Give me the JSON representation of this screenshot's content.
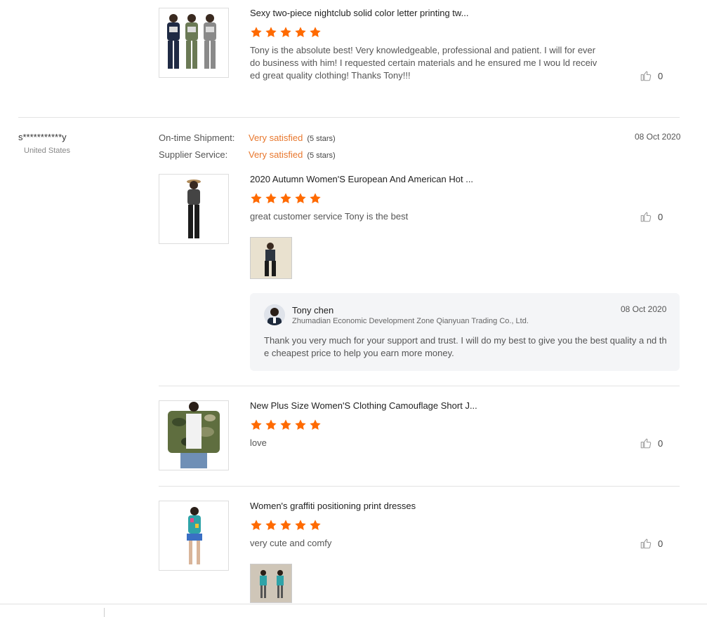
{
  "reviews_top": {
    "product_title": "Sexy two-piece nightclub solid color letter printing tw...",
    "rating": 5,
    "text": "Tony is the absolute best! Very knowledgeable, professional and patient. I will for ever do business with him! I requested certain materials and he ensured me I wou ld received great quality clothing! Thanks Tony!!!",
    "likes": "0"
  },
  "reviewer": {
    "name": "s***********y",
    "country": "United States",
    "date": "08 Oct 2020",
    "ratings": [
      {
        "label": "On-time Shipment:",
        "value": "Very satisfied",
        "stars": "(5 stars)"
      },
      {
        "label": "Supplier Service:",
        "value": "Very satisfied",
        "stars": "(5 stars)"
      }
    ],
    "items": [
      {
        "product_title": "2020 Autumn Women'S European And American Hot ...",
        "rating": 5,
        "text": "great customer service Tony is the best",
        "likes": "0"
      },
      {
        "product_title": "New Plus Size Women'S Clothing Camouflage Short J...",
        "rating": 5,
        "text": "love",
        "likes": "0"
      },
      {
        "product_title": "Women's graffiti positioning print dresses",
        "rating": 5,
        "text": "very cute and comfy",
        "likes": "0"
      }
    ],
    "reply": {
      "name": "Tony chen",
      "company": "Zhumadian Economic Development Zone Qianyuan Trading Co., Ltd.",
      "date": "08 Oct 2020",
      "text": "Thank you very much for your support and trust. I will do my best to give you the best quality a nd the cheapest price to help you earn more money."
    }
  },
  "colors": {
    "accent": "#e8772d",
    "star": "#ff6a00",
    "divider": "#e3e3e3",
    "reply_bg": "#f4f5f7"
  },
  "icons": {
    "like": "thumbs-up-icon",
    "star": "star-icon"
  }
}
